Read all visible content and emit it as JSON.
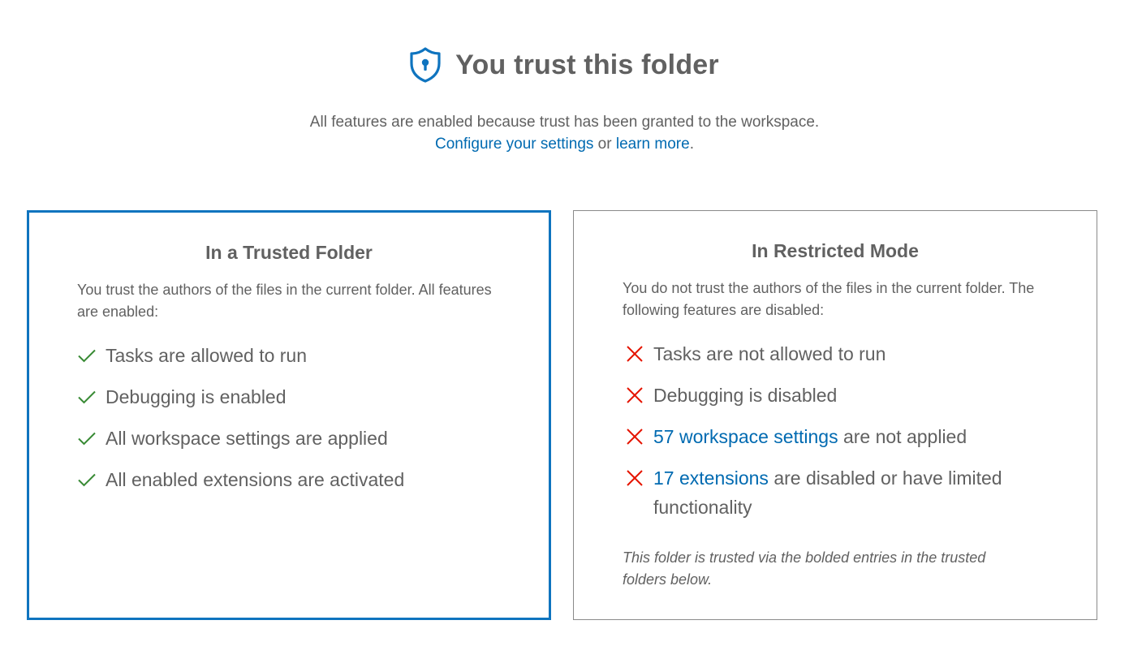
{
  "header": {
    "title": "You trust this folder",
    "shield_icon": "shield-lock-icon"
  },
  "subtitle": {
    "line1": "All features are enabled because trust has been granted to the workspace.",
    "configure_link": "Configure your settings",
    "or_text": " or ",
    "learn_link": "learn more",
    "period": "."
  },
  "trusted_card": {
    "title": "In a Trusted Folder",
    "description": "You trust the authors of the files in the current folder. All features are enabled:",
    "items": [
      {
        "icon": "check-icon",
        "text": "Tasks are allowed to run"
      },
      {
        "icon": "check-icon",
        "text": "Debugging is enabled"
      },
      {
        "icon": "check-icon",
        "text": "All workspace settings are applied"
      },
      {
        "icon": "check-icon",
        "text": "All enabled extensions are activated"
      }
    ]
  },
  "restricted_card": {
    "title": "In Restricted Mode",
    "description": "You do not trust the authors of the files in the current folder. The following features are disabled:",
    "items": [
      {
        "icon": "cross-icon",
        "text": "Tasks are not allowed to run"
      },
      {
        "icon": "cross-icon",
        "text": "Debugging is disabled"
      },
      {
        "icon": "cross-icon",
        "link": "57 workspace settings",
        "text": " are not applied"
      },
      {
        "icon": "cross-icon",
        "link": "17 extensions",
        "text": " are disabled or have limited functionality"
      }
    ],
    "footnote": "This folder is trusted via the bolded entries in the trusted folders below."
  },
  "colors": {
    "accent": "#0f74bf",
    "link": "#006ab1",
    "check": "#388a34",
    "cross": "#e51400",
    "text": "#616161"
  }
}
